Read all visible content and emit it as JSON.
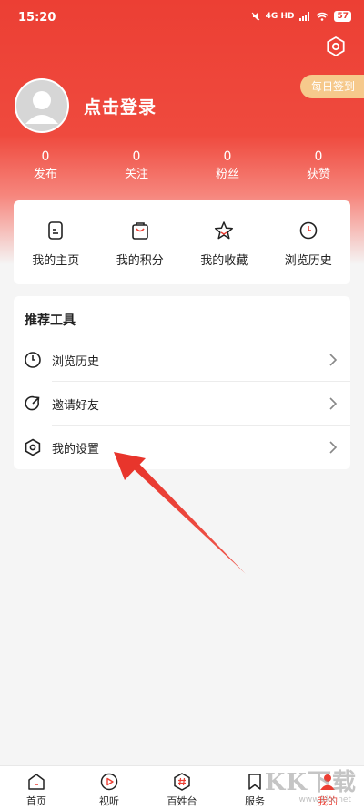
{
  "status_bar": {
    "time": "15:20",
    "network": "4G HD",
    "battery": "57"
  },
  "header": {
    "checkin_label": "每日签到",
    "login_label": "点击登录",
    "stats": [
      {
        "value": "0",
        "label": "发布"
      },
      {
        "value": "0",
        "label": "关注"
      },
      {
        "value": "0",
        "label": "粉丝"
      },
      {
        "value": "0",
        "label": "获赞"
      }
    ]
  },
  "quick_actions": [
    {
      "label": "我的主页",
      "icon": "homepage-icon"
    },
    {
      "label": "我的积分",
      "icon": "points-bag-icon"
    },
    {
      "label": "我的收藏",
      "icon": "star-icon"
    },
    {
      "label": "浏览历史",
      "icon": "clock-icon"
    }
  ],
  "tools": {
    "title": "推荐工具",
    "items": [
      {
        "label": "浏览历史",
        "icon": "clock-icon"
      },
      {
        "label": "邀请好友",
        "icon": "share-refresh-icon"
      },
      {
        "label": "我的设置",
        "icon": "settings-hex-icon"
      }
    ]
  },
  "tab_bar": {
    "active": 4,
    "items": [
      {
        "label": "首页"
      },
      {
        "label": "视听"
      },
      {
        "label": "百姓台"
      },
      {
        "label": "服务"
      },
      {
        "label": "我的"
      }
    ]
  },
  "watermark": {
    "main": "KK下载",
    "sub": "www.kkx.net"
  },
  "colors": {
    "accent": "#ec3f34",
    "checkin": "#f6c98c",
    "arrow": "#e8352c"
  }
}
